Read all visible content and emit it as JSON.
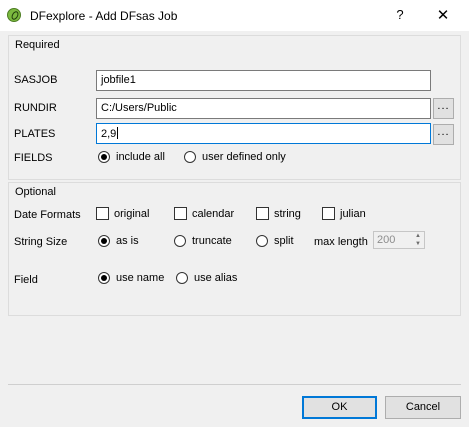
{
  "window": {
    "title": "DFexplore - Add DFsas Job",
    "help_label": "?",
    "close_label": "✕"
  },
  "required": {
    "group_title": "Required",
    "sasjob": {
      "label": "SASJOB",
      "value": "jobfile1"
    },
    "rundir": {
      "label": "RUNDIR",
      "value": "C:/Users/Public",
      "browse_label": "..."
    },
    "plates": {
      "label": "PLATES",
      "value": "2,9",
      "browse_label": "..."
    },
    "fields": {
      "label": "FIELDS",
      "options": [
        {
          "label": "include all",
          "checked": true
        },
        {
          "label": "user defined only",
          "checked": false
        }
      ]
    }
  },
  "optional": {
    "group_title": "Optional",
    "date_formats": {
      "label": "Date Formats",
      "options": [
        {
          "label": "original",
          "checked": false
        },
        {
          "label": "calendar",
          "checked": false
        },
        {
          "label": "string",
          "checked": false
        },
        {
          "label": "julian",
          "checked": false
        }
      ]
    },
    "string_size": {
      "label": "String Size",
      "options": [
        {
          "label": "as is",
          "checked": true
        },
        {
          "label": "truncate",
          "checked": false
        },
        {
          "label": "split",
          "checked": false
        }
      ],
      "max_length_label": "max length",
      "max_length_value": "200"
    },
    "field": {
      "label": "Field",
      "options": [
        {
          "label": "use name",
          "checked": true
        },
        {
          "label": "use alias",
          "checked": false
        }
      ]
    }
  },
  "buttons": {
    "ok_label": "OK",
    "cancel_label": "Cancel"
  },
  "icons": {
    "app": "dfexplore-app-icon",
    "spin_up": "▲",
    "spin_down": "▼"
  },
  "colors": {
    "focus": "#0078d7",
    "client_bg": "#f0f0f0",
    "app_icon": "#7bb93f"
  }
}
